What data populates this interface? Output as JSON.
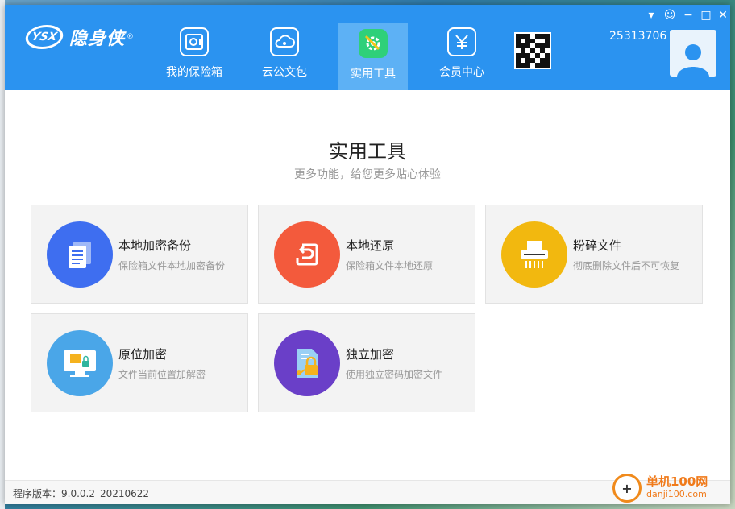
{
  "app": {
    "logo_mark": "YSX",
    "logo_text": "隐身侠",
    "logo_reg": "®"
  },
  "nav": {
    "tabs": [
      {
        "label": "我的保险箱",
        "icon": "safe-icon",
        "active": false
      },
      {
        "label": "云公文包",
        "icon": "cloud-icon",
        "active": false
      },
      {
        "label": "实用工具",
        "icon": "tools-icon",
        "active": true
      },
      {
        "label": "会员中心",
        "icon": "yuan-icon",
        "active": false
      }
    ]
  },
  "user": {
    "id": "25313706"
  },
  "window_controls": {
    "menu": "▾",
    "skin": "☺",
    "minimize": "−",
    "maximize": "□",
    "close": "✕"
  },
  "page": {
    "title": "实用工具",
    "subtitle": "更多功能，给您更多贴心体验"
  },
  "tools": [
    {
      "title": "本地加密备份",
      "desc": "保险箱文件本地加密备份",
      "icon": "document-copy-icon",
      "color": "#3e6ef0"
    },
    {
      "title": "本地还原",
      "desc": "保险箱文件本地还原",
      "icon": "restore-icon",
      "color": "#f35a3c"
    },
    {
      "title": "粉碎文件",
      "desc": "彻底删除文件后不可恢复",
      "icon": "shredder-icon",
      "color": "#f2b80f"
    },
    {
      "title": "原位加密",
      "desc": "文件当前位置加解密",
      "icon": "monitor-lock-icon",
      "color": "#4aa6e8"
    },
    {
      "title": "独立加密",
      "desc": "使用独立密码加密文件",
      "icon": "file-lock-icon",
      "color": "#6a3fc8"
    }
  ],
  "footer": {
    "version": "程序版本：9.0.0.2_20210622"
  },
  "watermark": {
    "title": "单机100网",
    "url": "danji100.com"
  },
  "colors": {
    "header": "#2b93f0",
    "active_tab": "#5db1f5",
    "active_icon": "#2fd07a"
  }
}
